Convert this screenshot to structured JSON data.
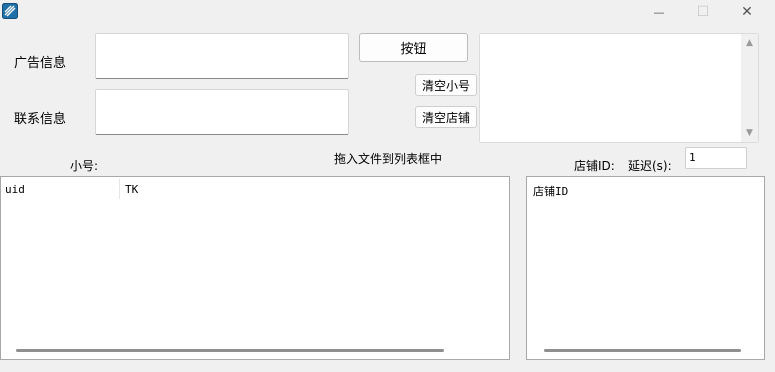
{
  "window": {
    "minimize_glyph": "—",
    "maximize_glyph": "☐",
    "close_glyph": "✕"
  },
  "form": {
    "ad_info_label": "广告信息",
    "contact_info_label": "联系信息",
    "ad_info_value": "",
    "contact_info_value": "",
    "button_label": "按钮",
    "clear_accounts_label": "清空小号",
    "clear_shops_label": "清空店铺",
    "log_text": ""
  },
  "labels": {
    "accounts": "小号:",
    "drag_hint": "拖入文件到列表框中",
    "shop_id": "店铺ID:",
    "delay": "延迟(s):"
  },
  "delay_value": "1",
  "accounts_list": {
    "columns": [
      "uid",
      "TK"
    ],
    "rows": []
  },
  "shop_list": {
    "columns": [
      "店铺ID"
    ],
    "rows": []
  }
}
